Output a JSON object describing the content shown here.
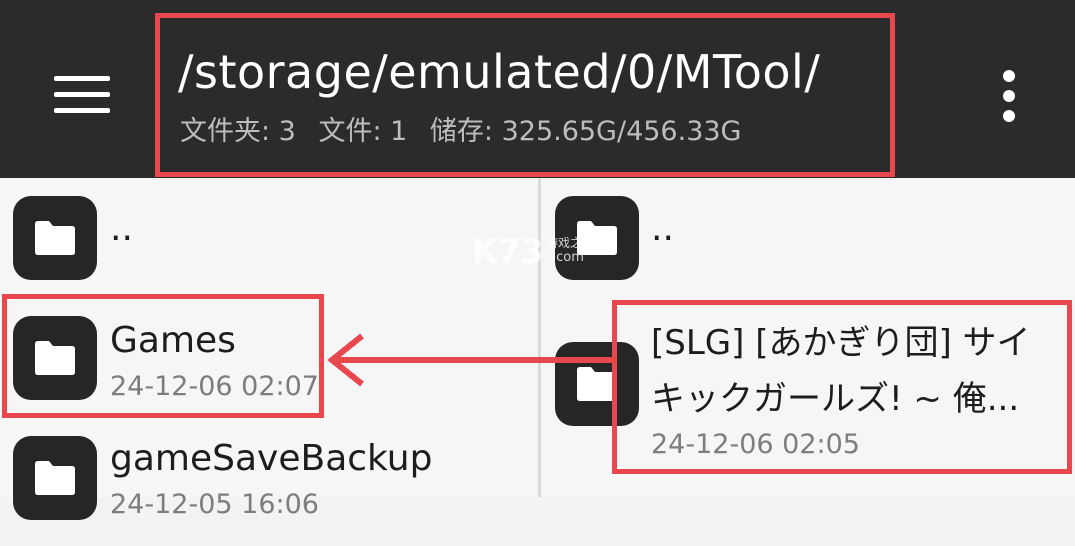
{
  "header": {
    "path": "/storage/emulated/0/MTool/",
    "folders_label": "文件夹: 3",
    "files_label": "文件: 1",
    "storage_label": "储存: 325.65G/456.33G"
  },
  "left_pane": {
    "items": [
      {
        "name": "..",
        "date": ""
      },
      {
        "name": "Games",
        "date": "24-12-06 02:07"
      },
      {
        "name": "gameSaveBackup",
        "date": "24-12-05 16:06"
      }
    ]
  },
  "right_pane": {
    "items": [
      {
        "name": "..",
        "date": ""
      },
      {
        "name_line1": "[SLG] [あかぎり団] サイ",
        "name_line2": "キックガールズ! ~ 俺...",
        "date": "24-12-06 02:05"
      }
    ]
  },
  "watermark": {
    "main": "K73",
    "sub1": "游戏之家",
    "sub2": ".com"
  },
  "colors": {
    "topbar": "#2b2b2b",
    "annotation": "#e8474c",
    "folder_tile": "#262626"
  },
  "icons": [
    "menu-icon",
    "more-vert-icon",
    "folder-icon",
    "arrow-left-icon"
  ]
}
